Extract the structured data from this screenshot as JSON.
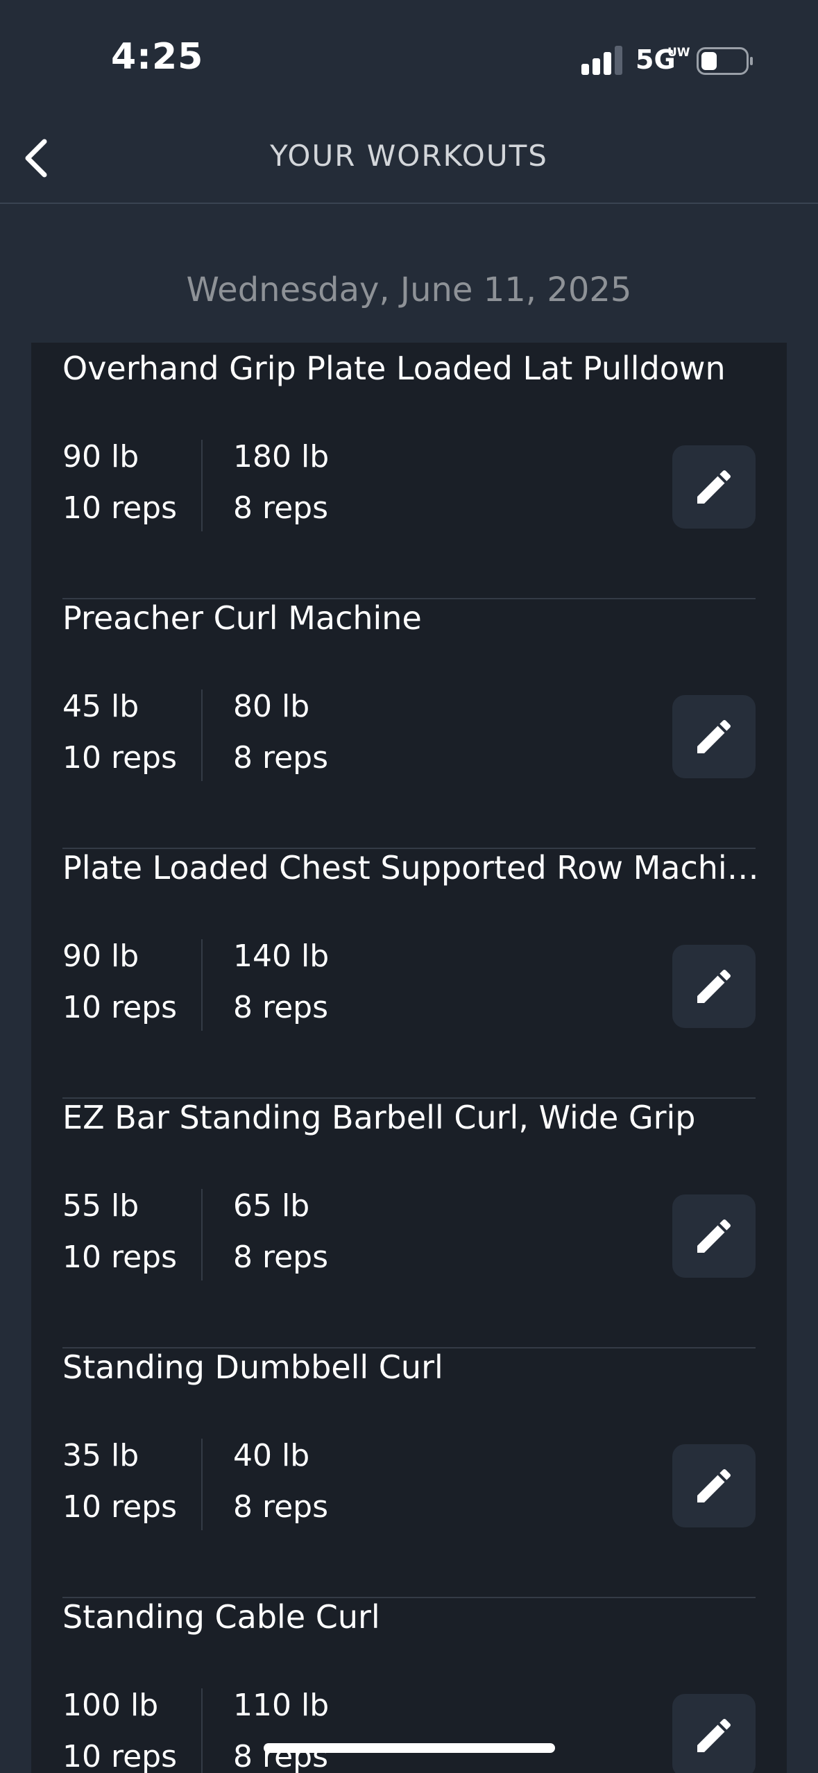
{
  "status_bar": {
    "time": "4:25",
    "network": "5G",
    "network_sup": "UW",
    "signal_icon": "cellular-signal-icon",
    "battery_icon": "battery-icon"
  },
  "nav": {
    "back_icon": "chevron-left-icon",
    "title": "YOUR WORKOUTS"
  },
  "date_heading": "Wednesday, June 11, 2025",
  "workouts": [
    {
      "name": "Overhand Grip Plate Loaded Lat Pulldown",
      "sets": [
        {
          "weight": "90 lb",
          "reps": "10 reps"
        },
        {
          "weight": "180 lb",
          "reps": "8 reps"
        }
      ]
    },
    {
      "name": "Preacher Curl Machine",
      "sets": [
        {
          "weight": "45 lb",
          "reps": "10 reps"
        },
        {
          "weight": "80 lb",
          "reps": "8 reps"
        }
      ]
    },
    {
      "name": "Plate Loaded Chest Supported Row Machi…",
      "sets": [
        {
          "weight": "90 lb",
          "reps": "10 reps"
        },
        {
          "weight": "140 lb",
          "reps": "8 reps"
        }
      ]
    },
    {
      "name": "EZ Bar Standing Barbell Curl, Wide Grip",
      "sets": [
        {
          "weight": "55 lb",
          "reps": "10 reps"
        },
        {
          "weight": "65 lb",
          "reps": "8 reps"
        }
      ]
    },
    {
      "name": "Standing Dumbbell Curl",
      "sets": [
        {
          "weight": "35 lb",
          "reps": "10 reps"
        },
        {
          "weight": "40 lb",
          "reps": "8 reps"
        }
      ]
    },
    {
      "name": "Standing Cable Curl",
      "sets": [
        {
          "weight": "100 lb",
          "reps": "10 reps"
        },
        {
          "weight": "110 lb",
          "reps": "8 reps"
        }
      ]
    }
  ],
  "edit_icon": "pencil-icon",
  "colors": {
    "background": "#242c38",
    "card": "#1a1f27",
    "edit_button": "#262e3a",
    "muted_text": "#8e9297"
  }
}
